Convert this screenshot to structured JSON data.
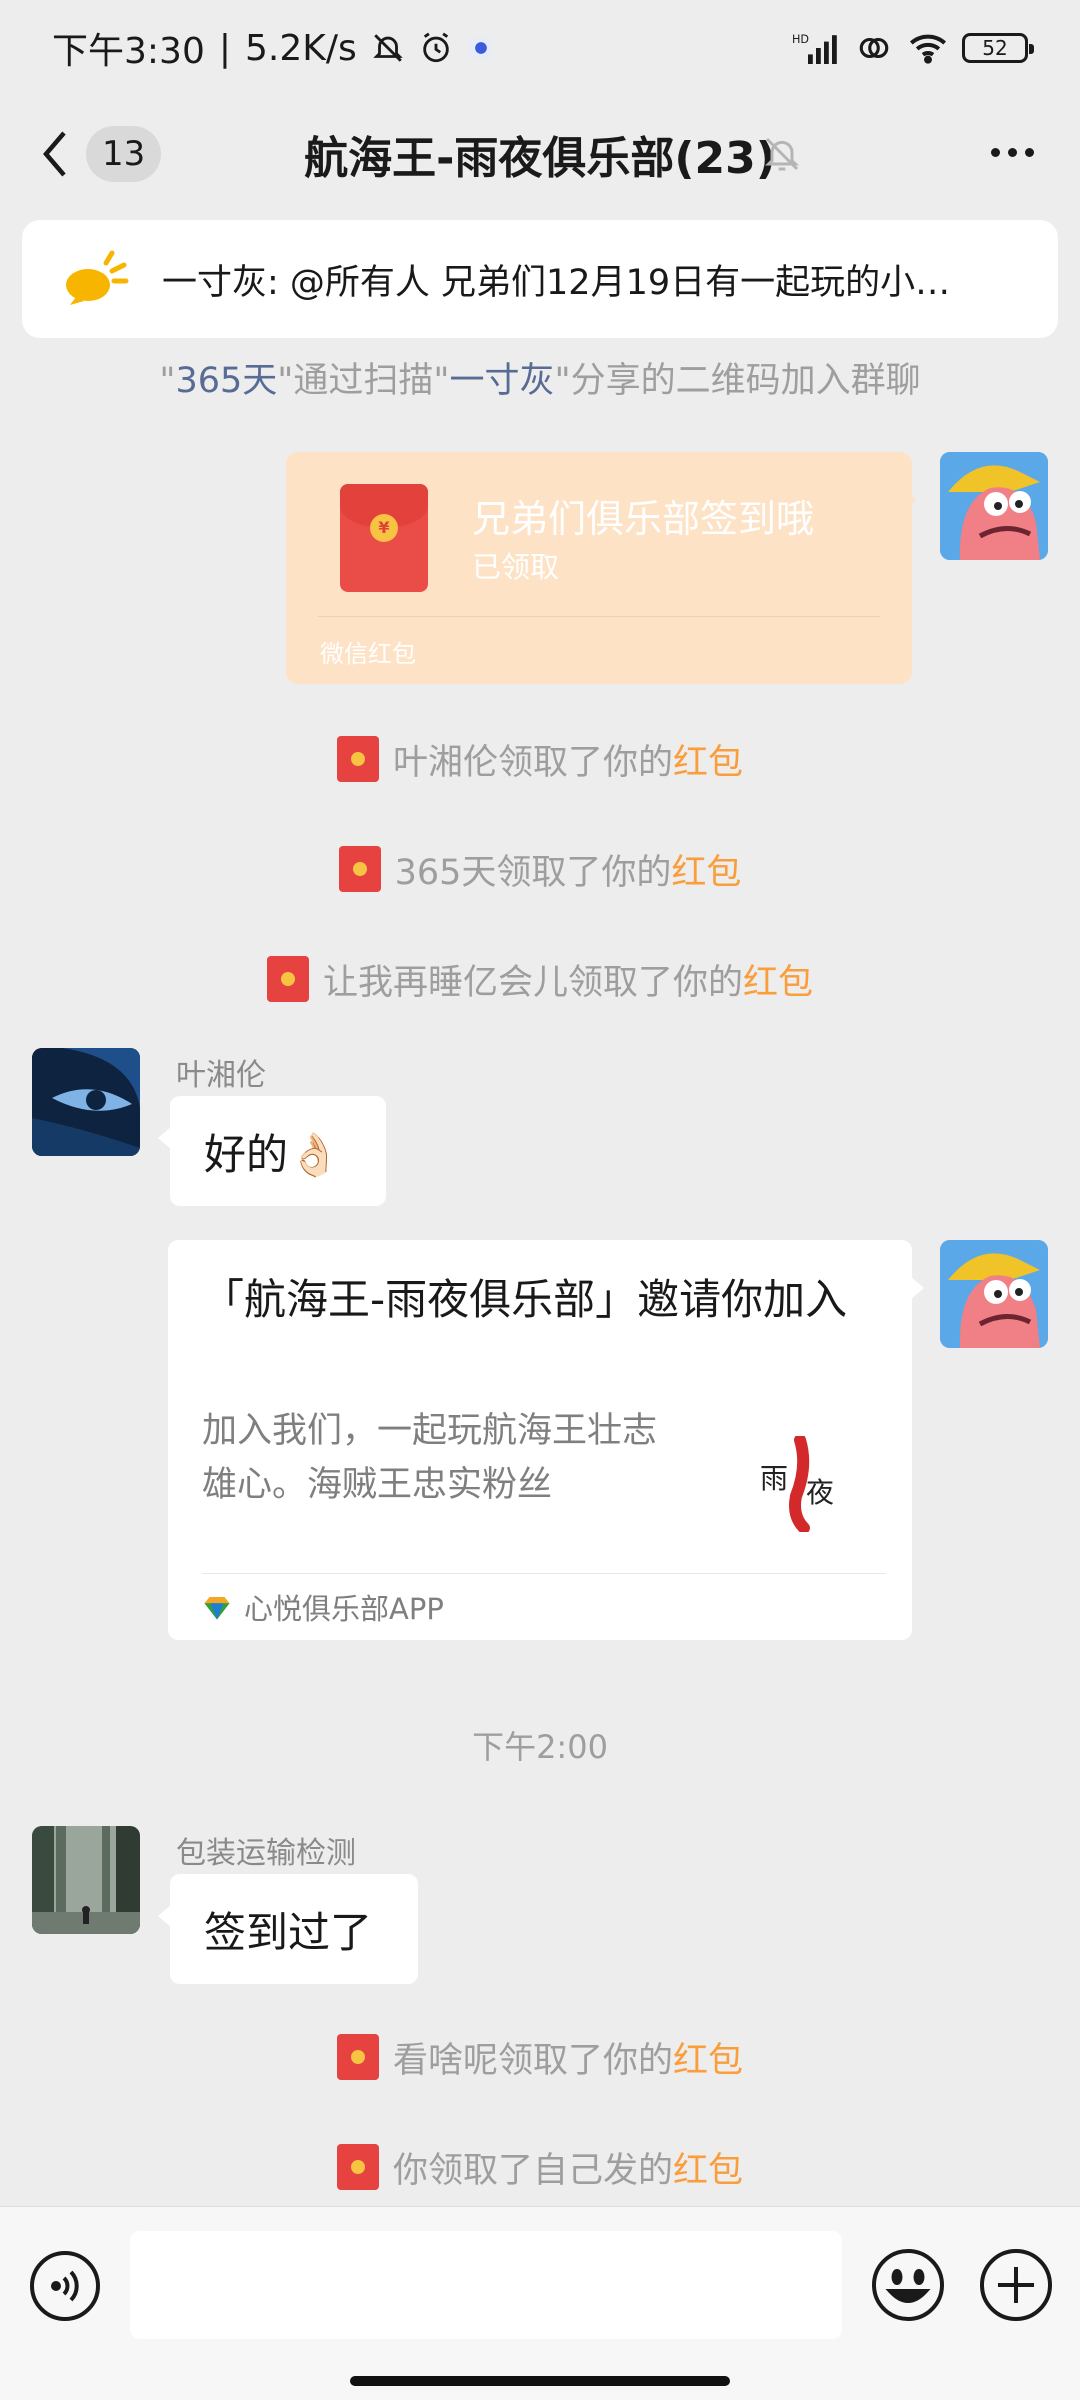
{
  "status_bar": {
    "time": "下午3:30",
    "speed": "5.2K/s",
    "battery": "52"
  },
  "header": {
    "unread_count": "13",
    "title": "航海王-雨夜俱乐部(23)"
  },
  "announcement": {
    "text": "一寸灰: @所有人 兄弟们12月19日有一起玩的小…"
  },
  "system": {
    "join_part1": "\"",
    "join_user1": "365天",
    "join_part2": "\"通过扫描\"",
    "join_user2": "一寸灰",
    "join_part3": "\"分享的二维码加入群聊"
  },
  "red_packet": {
    "title": "兄弟们俱乐部签到哦",
    "status": "已领取",
    "footer": "微信红包"
  },
  "receipts": [
    {
      "name": "叶湘伦",
      "action": "领取了你的",
      "link": "红包"
    },
    {
      "name": "365天",
      "action": "领取了你的",
      "link": "红包"
    },
    {
      "name": "让我再睡亿会儿",
      "action": "领取了你的",
      "link": "红包"
    }
  ],
  "messages": [
    {
      "sender": "叶湘伦",
      "text": "好的👌🏻"
    },
    {
      "sender": "包装运输检测",
      "text": "签到过了"
    }
  ],
  "invite": {
    "title": "「航海王-雨夜俱乐部」邀请你加入",
    "desc": "加入我们，一起玩航海王壮志雄心。海贼王忠实粉丝",
    "app": "心悦俱乐部APP"
  },
  "timestamp": "下午2:00",
  "receipts2": [
    {
      "name": "看啥呢",
      "action": "领取了你的",
      "link": "红包"
    },
    {
      "name": "",
      "action": "你领取了自己发的",
      "link": "红包"
    }
  ],
  "input": {
    "placeholder": ""
  },
  "colors": {
    "background": "#ededed",
    "link_blue": "#576b95",
    "red_packet_orange": "#fa9d3b",
    "red_packet_card": "#fde2c6"
  }
}
